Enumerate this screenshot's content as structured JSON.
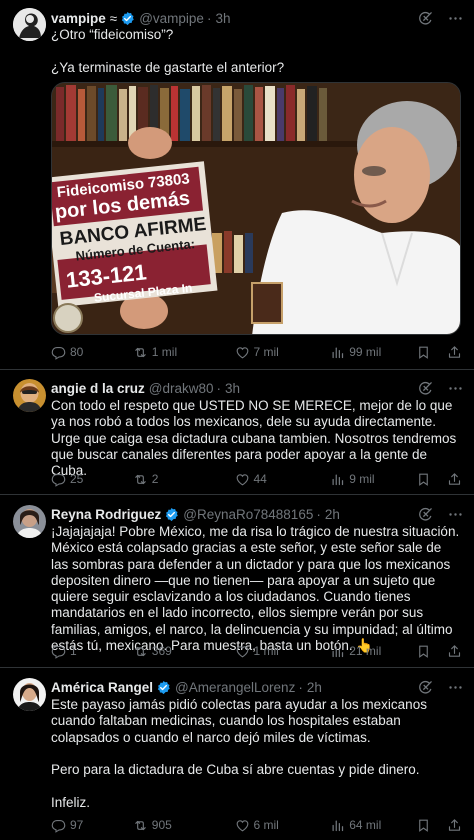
{
  "tweets": [
    {
      "name": "vampipe",
      "name_suffix": "≈",
      "handle": "@vampipe",
      "time": "3h",
      "text": "¿Otro “fideicomiso”?\n\n¿Ya terminaste de gastarte el anterior?",
      "replies": "80",
      "retweets": "1 mil",
      "likes": "7 mil",
      "views": "99 mil",
      "media": {
        "sign_line1": "Fideicomiso 73803",
        "sign_line2": "por los demás",
        "sign_line3": "BANCO AFIRME",
        "sign_line4": "Número de Cuenta:",
        "sign_line5": "133-121",
        "sign_line6": "Sucursal Plaza In"
      }
    },
    {
      "name": "angie d la cruz",
      "handle": "@drakw80",
      "time": "3h",
      "text": "Con todo el respeto que USTED NO SE MERECE, mejor de lo que ya nos robó a todos los mexicanos, dele su ayuda directamente. Urge que caiga esa dictadura cubana tambien. Nosotros tendremos que buscar canales diferentes para poder apoyar a la gente de Cuba.",
      "replies": "25",
      "retweets": "2",
      "likes": "44",
      "views": "9 mil"
    },
    {
      "name": "Reyna Rodriguez",
      "handle": "@ReynaRo78488165",
      "time": "2h",
      "text": "¡Jajajajaja! Pobre México, me da risa lo trágico de nuestra situación. México está colapsado gracias a este señor, y este señor sale de las sombras para defender a un dictador y para que los mexicanos depositen dinero —que no tienen— para apoyar a un sujeto que quiere seguir esclavizando a los ciudadanos. Cuando tienes mandatarios en el lado incorrecto, ellos siempre verán por sus familias, amigos, el narco, la delincuencia y su impunidad; al último estás tú, mexicano. Para muestra, basta un botón. 👆",
      "replies": "1",
      "retweets": "369",
      "likes": "1 mil",
      "views": "21 mil"
    },
    {
      "name": "América Rangel",
      "handle": "@AmerangelLorenz",
      "time": "2h",
      "text": "Este payaso jamás pidió colectas para ayudar a los mexicanos cuando faltaban medicinas, cuando los hospitales estaban colapsados o cuando el narco dejó miles de víctimas.\n\nPero para la dictadura de Cuba sí abre cuentas y pide dinero.\n\nInfeliz.",
      "replies": "97",
      "retweets": "905",
      "likes": "6 mil",
      "views": "64 mil"
    }
  ],
  "colors": {
    "background": "#000000",
    "text": "#e7e9ea",
    "muted": "#71767b",
    "verified": "#1d9bf0",
    "divider": "#2f3336",
    "sign": "#8a2232"
  },
  "icons": [
    "grok-icon",
    "more-icon",
    "reply-icon",
    "retweet-icon",
    "like-icon",
    "views-icon",
    "bookmark-icon",
    "share-icon",
    "verified-icon"
  ]
}
